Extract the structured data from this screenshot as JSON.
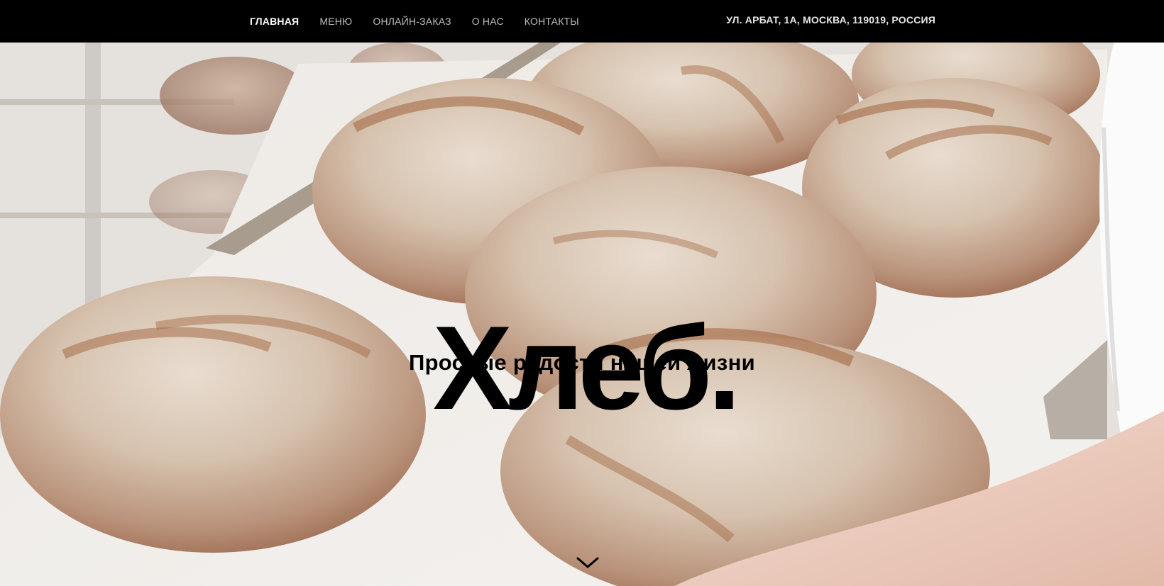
{
  "nav": {
    "items": [
      {
        "label": "ГЛАВНАЯ",
        "active": true
      },
      {
        "label": "МЕНЮ",
        "active": false
      },
      {
        "label": "ОНЛАЙН-ЗАКАЗ",
        "active": false
      },
      {
        "label": "О НАС",
        "active": false
      },
      {
        "label": "КОНТАКТЫ",
        "active": false
      }
    ],
    "address": "УЛ. АРБАТ, 1А, МОСКВА, 119019, РОССИЯ"
  },
  "hero": {
    "title": "Хлеб.",
    "subtitle": "Простые радости нашей жизни",
    "scroll_icon": "chevron-down-icon"
  },
  "colors": {
    "nav_bg": "#000000",
    "nav_text": "#bdbdbd",
    "nav_active": "#ffffff",
    "title_text": "#000000"
  }
}
